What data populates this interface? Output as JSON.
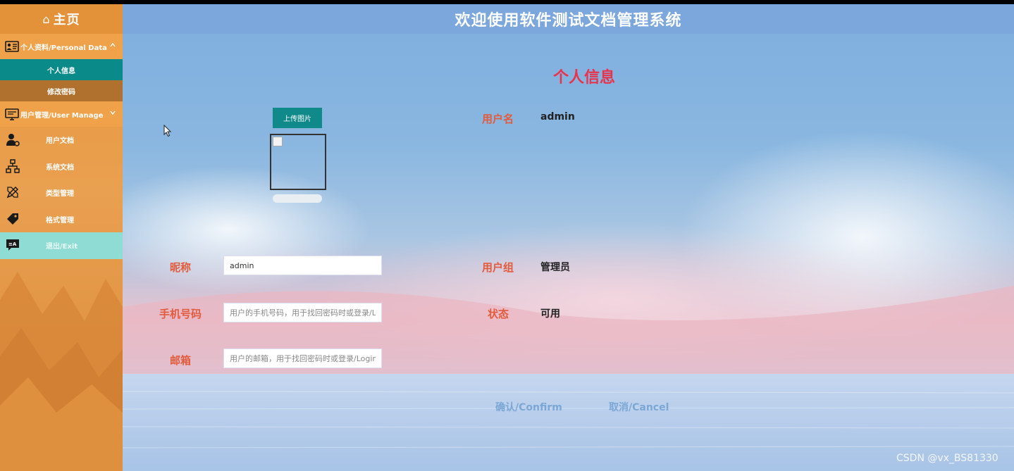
{
  "sidebar": {
    "home_label": "主页",
    "personal_section": "个人资料/Personal Data",
    "personal_items": [
      "个人信息",
      "修改密码"
    ],
    "user_section": "用户管理/User Manage",
    "nav_items": [
      "用户文档",
      "系统文档",
      "类型管理",
      "格式管理"
    ],
    "exit_label": "退出/Exit"
  },
  "header": {
    "title": "欢迎使用软件测试文档管理系统"
  },
  "form": {
    "title": "个人信息",
    "upload_label": "上传图片",
    "username_label": "用户名",
    "username_value": "admin",
    "nickname_label": "昵称",
    "nickname_value": "admin",
    "group_label": "用户组",
    "group_value": "管理员",
    "phone_label": "手机号码",
    "phone_placeholder": "用户的手机号码，用于找回密码时或登录/Login时",
    "status_label": "状态",
    "status_value": "可用",
    "email_label": "邮箱",
    "email_placeholder": "用户的邮箱，用于找回密码时或登录/Login时",
    "confirm_label": "确认/Confirm",
    "cancel_label": "取消/Cancel"
  },
  "watermark": "CSDN @vx_BS81330",
  "colors": {
    "accent_teal": "#10898a",
    "label_red": "#e35b3d",
    "title_red": "#e8334a",
    "sidebar_orange": "#e9a050"
  }
}
